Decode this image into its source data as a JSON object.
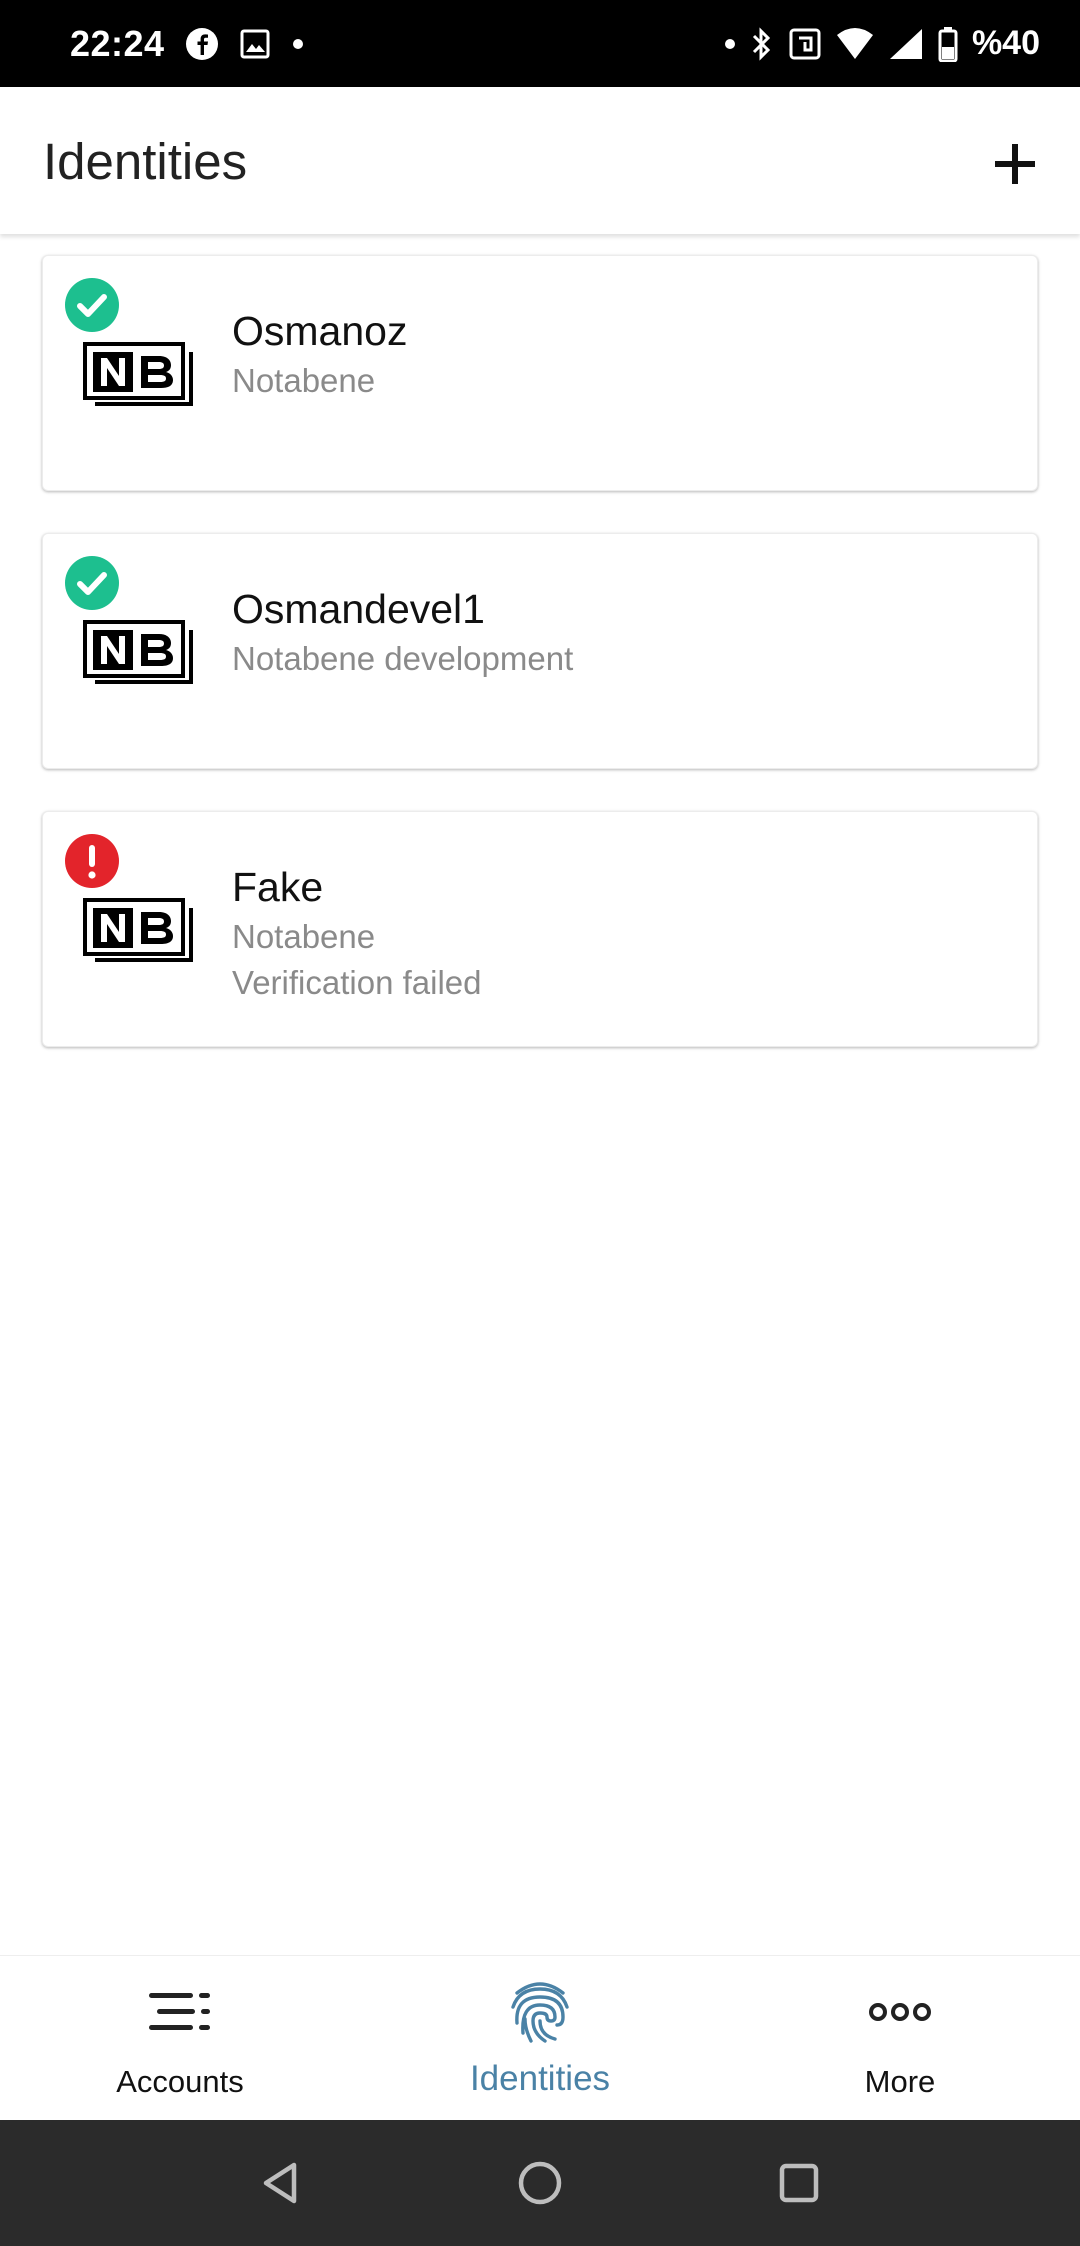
{
  "status_bar": {
    "time": "22:24",
    "battery": "%40",
    "left_icons": [
      "facebook-icon",
      "image-icon",
      "dot-icon"
    ],
    "right_icons": [
      "dot-icon",
      "bluetooth-icon",
      "nfc-icon",
      "wifi-icon",
      "signal-icon",
      "battery-icon"
    ]
  },
  "app_bar": {
    "title": "Identities",
    "add_icon": "plus-icon"
  },
  "identities": [
    {
      "name": "Osmanoz",
      "provider": "Notabene",
      "detail": "",
      "status": "verified",
      "status_color": "#1dbf8f",
      "logo": "nb-logo"
    },
    {
      "name": "Osmandevel1",
      "provider": "Notabene development",
      "detail": "",
      "status": "verified",
      "status_color": "#1dbf8f",
      "logo": "nb-logo"
    },
    {
      "name": "Fake",
      "provider": "Notabene",
      "detail": "Verification failed",
      "status": "failed",
      "status_color": "#e3242b",
      "logo": "nb-logo"
    }
  ],
  "bottom_nav": {
    "items": [
      {
        "label": "Accounts",
        "icon": "list-icon",
        "active": false
      },
      {
        "label": "Identities",
        "icon": "fingerprint-icon",
        "active": true
      },
      {
        "label": "More",
        "icon": "more-icon",
        "active": false
      }
    ],
    "active_color": "#4a82a6"
  },
  "system_nav": {
    "buttons": [
      "back-icon",
      "home-icon",
      "recents-icon"
    ]
  }
}
